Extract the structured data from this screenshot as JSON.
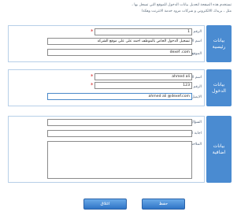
{
  "intro": {
    "line1": "تستخدم هذه الصفحة لتعديل بيانات الدخول للموقع التي تسجل بها ،",
    "line2": "مثل ، بريدك الالكتروني و شركات مزود خدمة الانترنت وهكذا"
  },
  "sections": {
    "basic": "بيانات رئيسية",
    "login": "بيانات الدخول",
    "extra": "بيانات اضافية"
  },
  "basic": {
    "number_label": "الرقم",
    "number_value": "1",
    "name_label": "اسم الخدمة",
    "name_value": "تسجيل الدخول الخاص بالموظف احمد على على موقع الشركة",
    "website_label": "الموقع الالكتروني",
    "website_value": "dexef .com"
  },
  "login": {
    "username_label": "اسم المستخدم",
    "username_value": "ahmed ali",
    "password_label": "الرقم السري",
    "password_value": "123",
    "email_label": "الايميل المستخدم",
    "email_value": "ahmed ali @dexef.com"
  },
  "extra": {
    "question_label": "السؤال السري",
    "question_value": "",
    "answer_label": "اجابة السؤال السري",
    "answer_value": "",
    "notes_label": "الملاحظات",
    "notes_value": ""
  },
  "buttons": {
    "save": "حفظ",
    "close": "اغلاق"
  },
  "colors": {
    "accent": "#4a8bd1",
    "required": "#d32424"
  }
}
